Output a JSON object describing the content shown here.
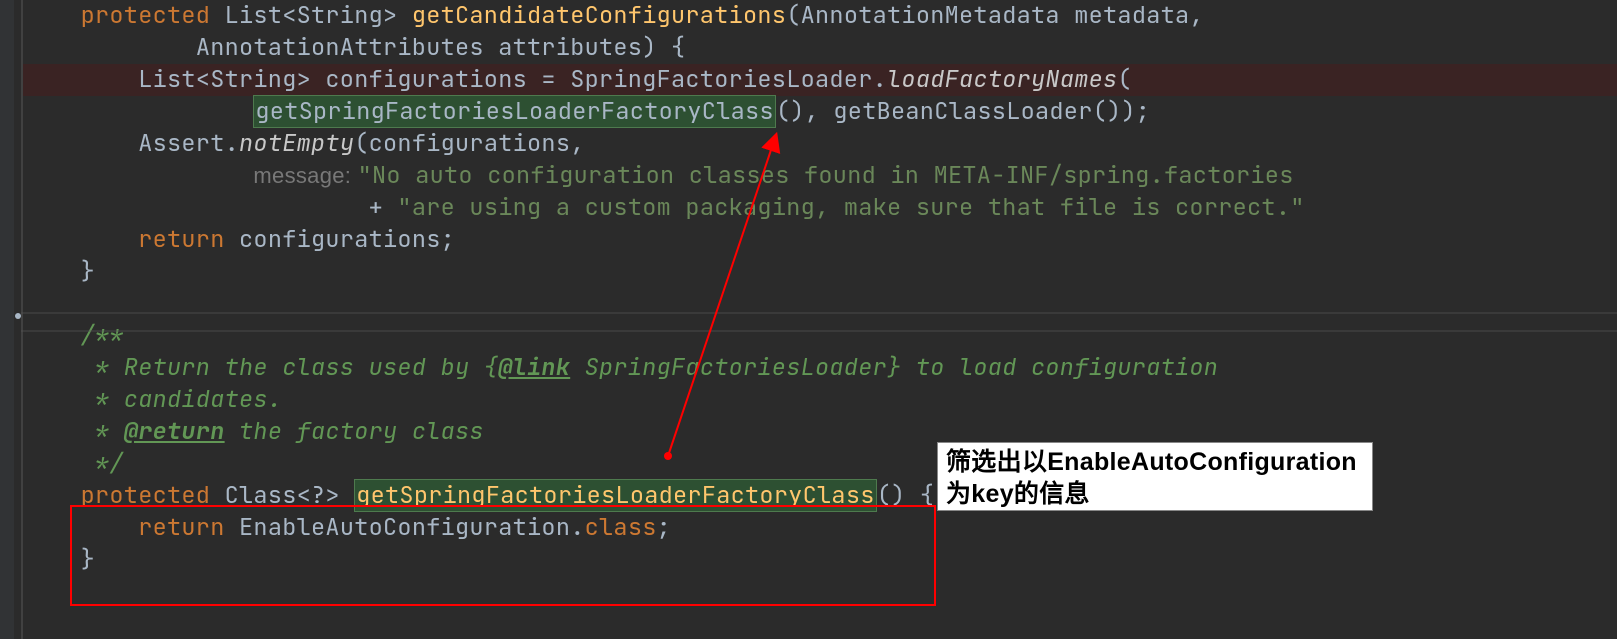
{
  "code": {
    "l1": {
      "kw1": "protected ",
      "type": "List<String> ",
      "method": "getCandidateConfigurations",
      "params": "(AnnotationMetadata metadata,"
    },
    "l2": {
      "indent": "            ",
      "rest": "AnnotationAttributes attributes) {"
    },
    "l3": {
      "indent": "        ",
      "type": "List<String> ",
      "var": "configurations = SpringFactoriesLoader.",
      "static": "loadFactoryNames",
      "open": "("
    },
    "l4": {
      "indent": "                ",
      "hl": "getSpringFactoriesLoaderFactoryClass",
      "rest": "(), getBeanClassLoader());"
    },
    "l5": {
      "indent": "        ",
      "call": "Assert.",
      "static": "notEmpty",
      "open": "(configurations,"
    },
    "l6": {
      "indent": "                ",
      "hint": "message: ",
      "str": "\"No auto configuration classes found in META-INF/spring.factories"
    },
    "l7": {
      "indent": "                        ",
      "plus": "+ ",
      "str": "\"are using a custom packaging, make sure that file is correct.\""
    },
    "l8": {
      "indent": "        ",
      "kw": "return ",
      "var": "configurations;"
    },
    "l9": {
      "indent": "    ",
      "brace": "}"
    },
    "l10": {
      "indent": "    ",
      "open": "/**"
    },
    "l11": {
      "indent": "     ",
      "text": "* Return the class used by {",
      "tag": "@link",
      "text2": " SpringFactoriesLoader} to load configuration"
    },
    "l12": {
      "indent": "     ",
      "text": "* candidates."
    },
    "l13": {
      "indent": "     ",
      "star": "* ",
      "tag": "@return",
      "text": " the factory class"
    },
    "l14": {
      "indent": "     ",
      "close": "*/"
    },
    "l15": {
      "indent": "    ",
      "kw": "protected ",
      "type": "Class<?> ",
      "method": "getSpringFactoriesLoaderFactoryClass",
      "rest": "() {"
    },
    "l16": {
      "indent": "        ",
      "kw": "return ",
      "cls": "EnableAutoConfiguration",
      "dot": ".",
      "kw2": "class",
      "semi": ";"
    },
    "l17": {
      "indent": "    ",
      "brace": "}"
    }
  },
  "callout": {
    "line1": "筛选出以EnableAutoConfiguration",
    "line2": "为key的信息"
  }
}
